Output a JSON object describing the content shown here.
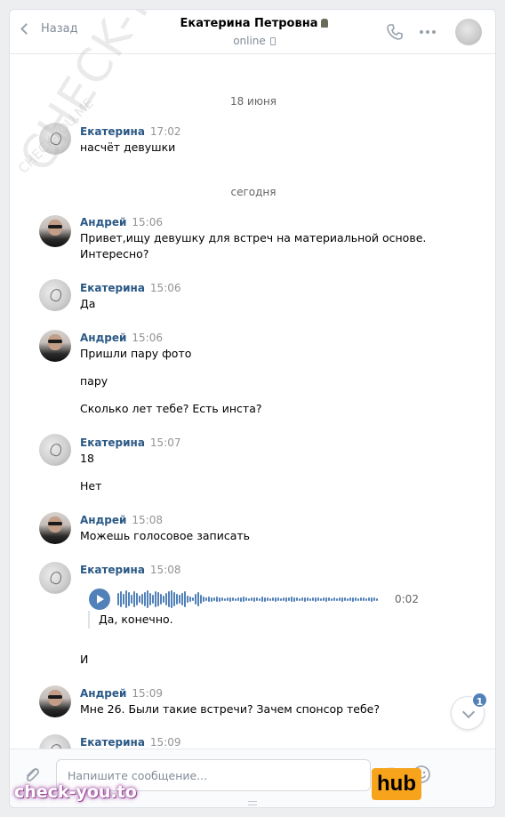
{
  "header": {
    "back_label": "Назад",
    "contact_name": "Екатерина Петровна",
    "status": "online",
    "icons": [
      "chevron-left-icon",
      "phone-icon",
      "more-icon",
      "avatar"
    ]
  },
  "dates": {
    "first": "18 июня",
    "second": "сегодня"
  },
  "messages": [
    {
      "author": "Екатерина",
      "time": "17:02",
      "lines": [
        "насчёт девушки"
      ]
    },
    {
      "author": "Андрей",
      "time": "15:06",
      "lines": [
        "Привет,ищу девушку для встреч на материальной основе.",
        "Интересно?"
      ]
    },
    {
      "author": "Екатерина",
      "time": "15:06",
      "lines": [
        "Да"
      ]
    },
    {
      "author": "Андрей",
      "time": "15:06",
      "lines": [
        "Пришли пару фото",
        "пару",
        "Сколько лет тебе? Есть инста?"
      ]
    },
    {
      "author": "Екатерина",
      "time": "15:07",
      "lines": [
        "18",
        "Нет"
      ]
    },
    {
      "author": "Андрей",
      "time": "15:08",
      "lines": [
        "Можешь голосовое записать"
      ]
    },
    {
      "author": "Екатерина",
      "time": "15:08",
      "voice": {
        "duration": "0:02",
        "transcript": "Да, конечно."
      },
      "lines": [
        "И"
      ]
    },
    {
      "author": "Андрей",
      "time": "15:09",
      "lines": [
        "Мне 26. Были такие встречи? Зачем спонсор тебе?"
      ]
    },
    {
      "author": "Екатерина",
      "time": "15:09",
      "lines": []
    }
  ],
  "scroll_badge": "1",
  "composer": {
    "placeholder": "Напишите сообщение..."
  },
  "watermarks": {
    "diagonal": "CHECK-YOU.ME",
    "small": "CHECK-YOU.ME",
    "site_logo": "check-you.to",
    "hub_logo": "hub"
  },
  "colors": {
    "link": "#2a5885",
    "accent": "#5181b8",
    "hub": "#f7a31c"
  }
}
